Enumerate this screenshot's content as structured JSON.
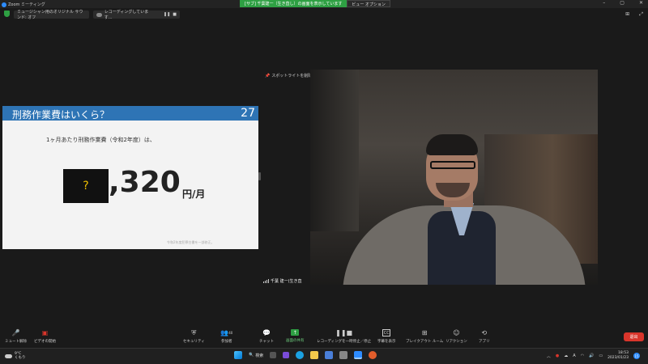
{
  "window": {
    "app_title": "Zoom ミーティング",
    "share_banner": "[サブ] 千葉建一（生き直し）の画面を表示しています",
    "view_option": "ビュー オプション"
  },
  "topbar": {
    "audio_label": "ミュージシャン用のオリジナル サウンド: オフ",
    "recording_label": "レコーディングしています..."
  },
  "slide": {
    "title": "刑務作業費はいくら？",
    "number": "27",
    "text": "1ヶ月あたり刑務作業費（令和2年度）は、",
    "hidden_digit": "?",
    "amount": ",320",
    "unit": "円/月",
    "footnote": "令和2年度犯罪白書を一部修正。"
  },
  "video": {
    "spotlight_label": "スポットライトを削除",
    "participant_name": "千葉 建一(生き直"
  },
  "toolbar": {
    "mute": "ミュート解除",
    "video": "ビデオの開始",
    "security": "セキュリティ",
    "participants": "参加者",
    "participants_count": "40",
    "chat": "チャット",
    "share": "画面の共有",
    "recording": "レコーディングを一時停止／停止",
    "captions": "字幕を表示",
    "breakout": "ブレイクアウト ルーム",
    "reactions": "リアクション",
    "apps": "アプリ",
    "end": "退出"
  },
  "taskbar": {
    "weather_temp": "9°C",
    "weather_desc": "くもり",
    "search": "検索",
    "ime": "A",
    "time": "18:53",
    "date": "2023/01/23",
    "notifications": "15"
  },
  "colors": {
    "slide_header": "#2e74b5",
    "share_green": "#2ea043",
    "end_red": "#d9352b",
    "zoom_blue": "#2d8cff"
  }
}
